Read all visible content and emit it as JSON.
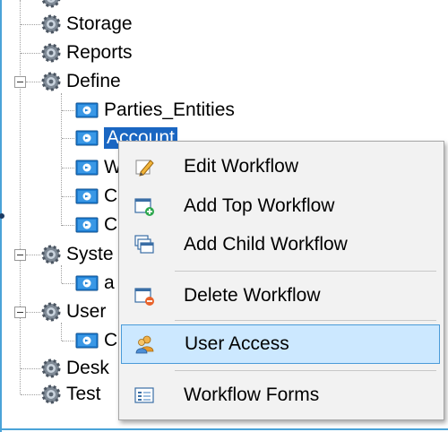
{
  "tree": {
    "items": [
      {
        "label": "Storage"
      },
      {
        "label": "Reports"
      },
      {
        "label": "Define"
      },
      {
        "label": "Parties_Entities"
      },
      {
        "label": "Account"
      },
      {
        "label": "W"
      },
      {
        "label": "C"
      },
      {
        "label": "C"
      },
      {
        "label": "Syste"
      },
      {
        "label": "a"
      },
      {
        "label": "User"
      },
      {
        "label": "C"
      },
      {
        "label": "Desk"
      },
      {
        "label": "Test"
      }
    ]
  },
  "context_menu": {
    "items": [
      {
        "label": "Edit Workflow",
        "icon": "pencil-icon"
      },
      {
        "label": "Add Top Workflow",
        "icon": "add-window-icon"
      },
      {
        "label": "Add Child Workflow",
        "icon": "stacked-windows-icon"
      },
      {
        "label": "Delete Workflow",
        "icon": "delete-window-icon"
      },
      {
        "label": "User Access",
        "icon": "users-icon"
      },
      {
        "label": "Workflow Forms",
        "icon": "form-icon"
      }
    ],
    "highlighted": "User Access"
  },
  "colors": {
    "selection": "#1a66c2",
    "menu_highlight": "#cce8ff",
    "menu_highlight_border": "#4a9bd9",
    "frame": "#4aa3d8"
  }
}
